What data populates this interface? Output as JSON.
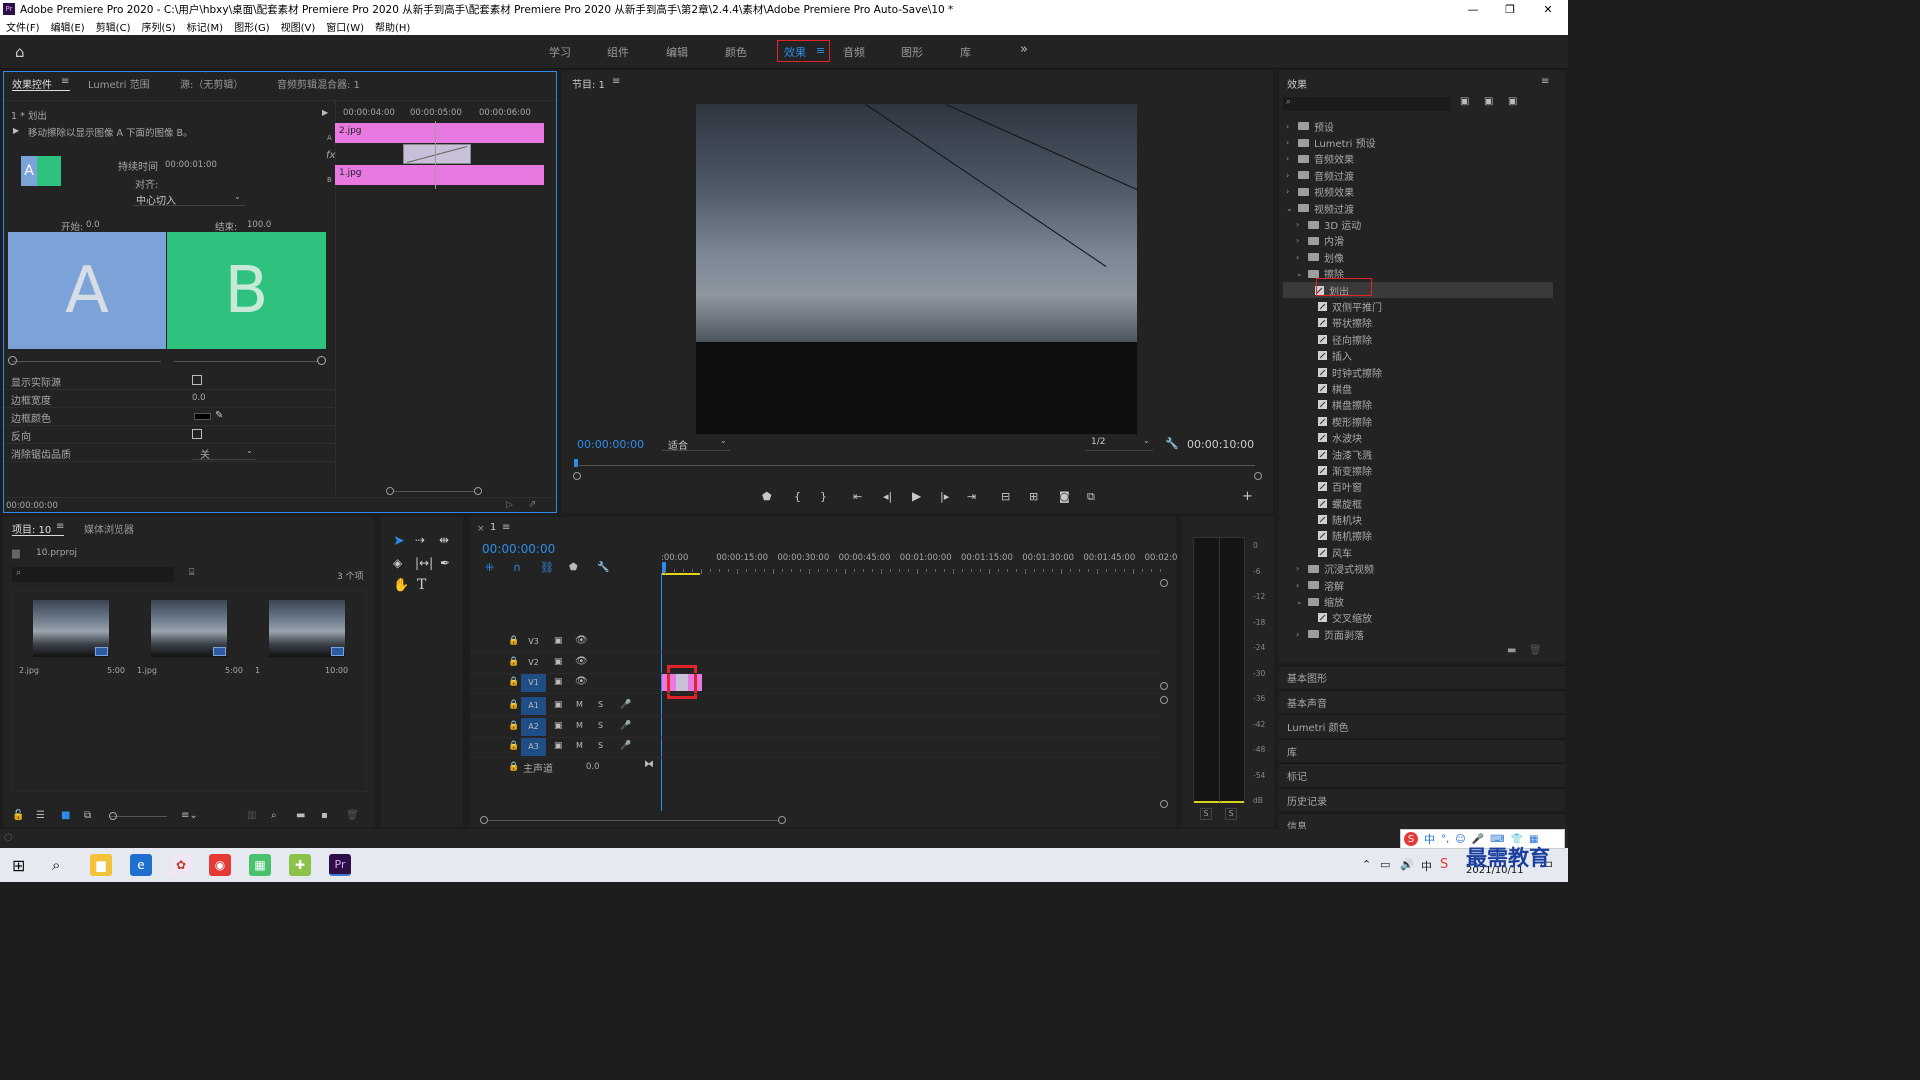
{
  "window": {
    "title": "Adobe Premiere Pro 2020 - C:\\用户\\hbxy\\桌面\\配套素材 Premiere Pro 2020 从新手到高手\\配套素材 Premiere Pro 2020 从新手到高手\\第2章\\2.4.4\\素材\\Adobe Premiere Pro Auto-Save\\10 *",
    "logo": "Pr"
  },
  "menu": [
    "文件(F)",
    "编辑(E)",
    "剪辑(C)",
    "序列(S)",
    "标记(M)",
    "图形(G)",
    "视图(V)",
    "窗口(W)",
    "帮助(H)"
  ],
  "workspaces": [
    "学习",
    "组件",
    "编辑",
    "颜色",
    "效果",
    "音频",
    "图形",
    "库"
  ],
  "effect_controls": {
    "tabs": [
      "效果控件",
      "Lumetri 范围",
      "源:（无剪辑）",
      "音频剪辑混合器: 1"
    ],
    "clip": "1 * 划出",
    "description": "移动擦除以显示图像 A 下面的图像 B。",
    "duration_label": "持续时间",
    "duration_value": "00:00:01:00",
    "align_label": "对齐:",
    "align_value": "中心切入",
    "ruler": [
      "00:00:04:00",
      "00:00:05:00",
      "00:00:06:00"
    ],
    "clip_a": "2.jpg",
    "clip_b": "1.jpg",
    "track_a": "A",
    "track_b": "B",
    "fx": "fx",
    "start_label": "开始:",
    "start_value": "0.0",
    "end_label": "结束:",
    "end_value": "100.0",
    "preview_a": "A",
    "preview_b": "B",
    "preview_a_color": "#7ba3d8",
    "preview_b_color": "#2ec27e",
    "props": [
      {
        "label": "显示实际源",
        "value": ""
      },
      {
        "label": "边框宽度",
        "value": "0.0"
      },
      {
        "label": "边框颜色",
        "value": ""
      },
      {
        "label": "反向",
        "value": ""
      },
      {
        "label": "消除锯齿品质",
        "value": "关"
      }
    ],
    "time": "00:00:00:00"
  },
  "program": {
    "title": "节目: 1",
    "timecode": "00:00:00:00",
    "fit": "适合",
    "resolution": "1/2",
    "duration": "00:00:10:00"
  },
  "effects_panel": {
    "title": "效果",
    "tree": [
      {
        "label": "预设",
        "type": "folder",
        "level": 0,
        "open": false
      },
      {
        "label": "Lumetri 预设",
        "type": "folder",
        "level": 0,
        "open": false
      },
      {
        "label": "音频效果",
        "type": "folder",
        "level": 0,
        "open": false
      },
      {
        "label": "音频过渡",
        "type": "folder",
        "level": 0,
        "open": false
      },
      {
        "label": "视频效果",
        "type": "folder",
        "level": 0,
        "open": false
      },
      {
        "label": "视频过渡",
        "type": "folder",
        "level": 0,
        "open": true
      },
      {
        "label": "3D 运动",
        "type": "folder",
        "level": 1,
        "open": false
      },
      {
        "label": "内滑",
        "type": "folder",
        "level": 1,
        "open": false
      },
      {
        "label": "划像",
        "type": "folder",
        "level": 1,
        "open": false
      },
      {
        "label": "擦除",
        "type": "folder",
        "level": 1,
        "open": true
      },
      {
        "label": "划出",
        "type": "fx",
        "level": 2,
        "selected": true
      },
      {
        "label": "双侧平推门",
        "type": "fx",
        "level": 2
      },
      {
        "label": "带状擦除",
        "type": "fx",
        "level": 2
      },
      {
        "label": "径向擦除",
        "type": "fx",
        "level": 2
      },
      {
        "label": "插入",
        "type": "fx",
        "level": 2
      },
      {
        "label": "时钟式擦除",
        "type": "fx",
        "level": 2
      },
      {
        "label": "棋盘",
        "type": "fx",
        "level": 2
      },
      {
        "label": "棋盘擦除",
        "type": "fx",
        "level": 2
      },
      {
        "label": "楔形擦除",
        "type": "fx",
        "level": 2
      },
      {
        "label": "水波块",
        "type": "fx",
        "level": 2
      },
      {
        "label": "油漆飞溅",
        "type": "fx",
        "level": 2
      },
      {
        "label": "渐变擦除",
        "type": "fx",
        "level": 2
      },
      {
        "label": "百叶窗",
        "type": "fx",
        "level": 2
      },
      {
        "label": "螺旋框",
        "type": "fx",
        "level": 2
      },
      {
        "label": "随机块",
        "type": "fx",
        "level": 2
      },
      {
        "label": "随机擦除",
        "type": "fx",
        "level": 2
      },
      {
        "label": "风车",
        "type": "fx",
        "level": 2
      },
      {
        "label": "沉浸式视频",
        "type": "folder",
        "level": 1,
        "open": false
      },
      {
        "label": "溶解",
        "type": "folder",
        "level": 1,
        "open": false
      },
      {
        "label": "缩放",
        "type": "folder",
        "level": 1,
        "open": true
      },
      {
        "label": "交叉缩放",
        "type": "fx",
        "level": 2
      },
      {
        "label": "页面剥落",
        "type": "folder",
        "level": 1,
        "open": false
      }
    ],
    "sections": [
      "基本图形",
      "基本声音",
      "Lumetri 颜色",
      "库",
      "标记",
      "历史记录",
      "信息"
    ]
  },
  "project": {
    "tabs": [
      "项目: 10",
      "媒体浏览器"
    ],
    "file": "10.prproj",
    "count": "3 个项",
    "items": [
      {
        "name": "2.jpg",
        "duration": "5:00"
      },
      {
        "name": "1.jpg",
        "duration": "5:00"
      },
      {
        "name": "1",
        "duration": "10:00"
      }
    ]
  },
  "timeline": {
    "tab": "1",
    "timecode": "00:00:00:00",
    "ruler": [
      ":00:00",
      "00:00:15:00",
      "00:00:30:00",
      "00:00:45:00",
      "00:01:00:00",
      "00:01:15:00",
      "00:01:30:00",
      "00:01:45:00",
      "00:02:0"
    ],
    "video_tracks": [
      "V3",
      "V2",
      "V1"
    ],
    "audio_tracks": [
      "A1",
      "A2",
      "A3"
    ],
    "master": "主声道",
    "master_value": "0.0",
    "m": "M",
    "s": "S"
  },
  "meter": {
    "scale": [
      "0",
      "-6",
      "-12",
      "-18",
      "-24",
      "-30",
      "-36",
      "-42",
      "-48",
      "-54",
      "dB"
    ],
    "solo": [
      "S",
      "S"
    ]
  },
  "taskbar": {
    "date": "2021/10/11",
    "ime": "中",
    "watermark": "最需教育"
  }
}
